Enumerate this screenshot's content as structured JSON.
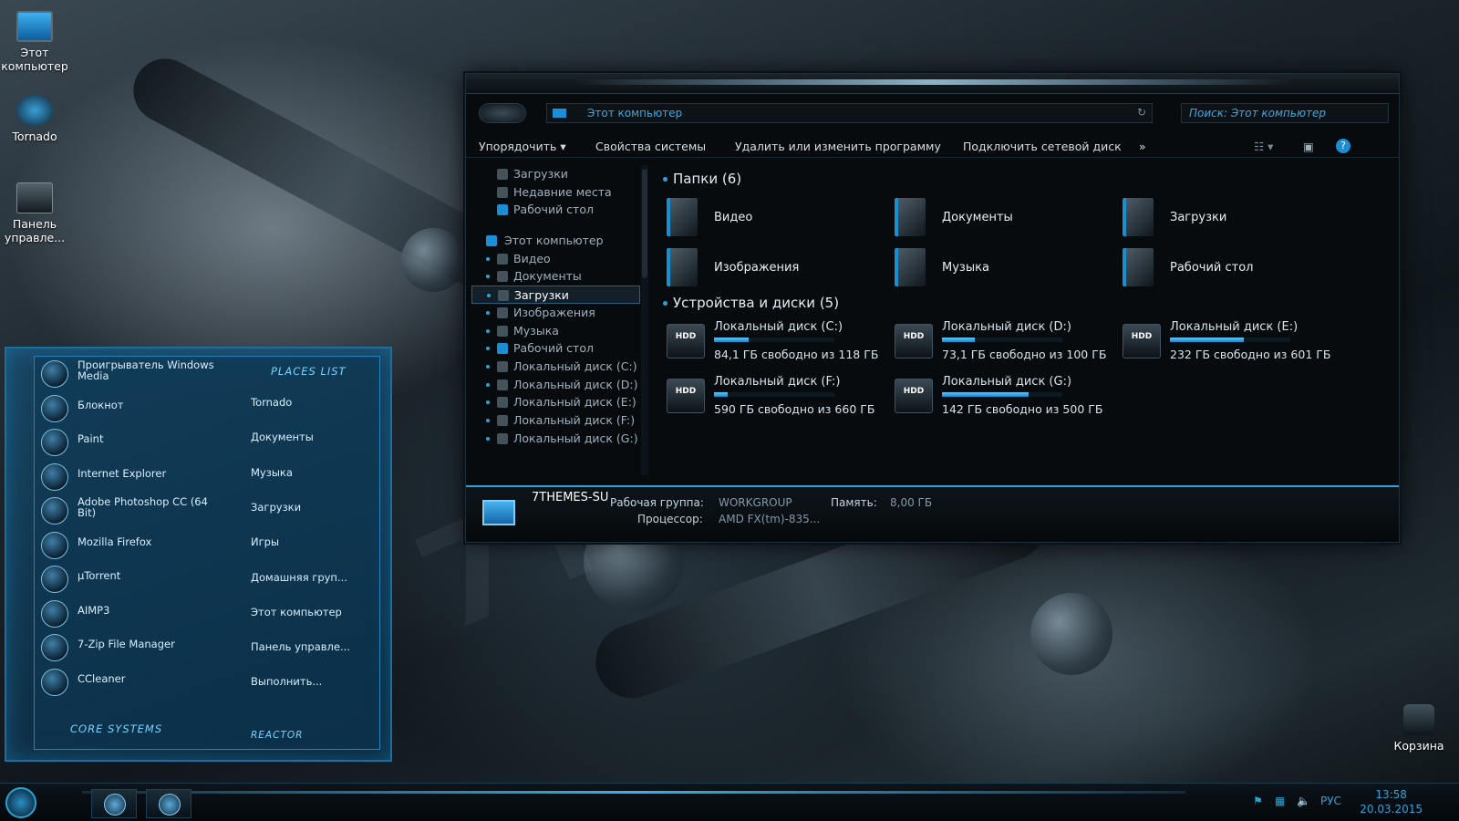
{
  "desktop": {
    "icons": [
      {
        "label": "Этот компьютер",
        "icon": "computer-icon"
      },
      {
        "label": "Tornado",
        "icon": "tornado-icon"
      },
      {
        "label": "Панель управле...",
        "icon": "control-panel-icon"
      },
      {
        "label": "Корзина",
        "icon": "recycle-bin-icon"
      }
    ]
  },
  "explorer": {
    "address": "Этот компьютер",
    "search_placeholder": "Поиск: Этот компьютер",
    "toolbar": {
      "organize": "Упорядочить ▾",
      "system_props": "Свойства системы",
      "uninstall": "Удалить или изменить программу",
      "map_drive": "Подключить сетевой диск",
      "more": "»"
    },
    "nav": [
      {
        "label": "Загрузки"
      },
      {
        "label": "Недавние места"
      },
      {
        "label": "Рабочий стол"
      },
      {
        "label": "Этот компьютер"
      },
      {
        "label": "Видео"
      },
      {
        "label": "Документы"
      },
      {
        "label": "Загрузки"
      },
      {
        "label": "Изображения"
      },
      {
        "label": "Музыка"
      },
      {
        "label": "Рабочий стол"
      },
      {
        "label": "Локальный диск (C:)"
      },
      {
        "label": "Локальный диск (D:)"
      },
      {
        "label": "Локальный диск (E:)"
      },
      {
        "label": "Локальный диск (F:)"
      },
      {
        "label": "Локальный диск (G:)"
      }
    ],
    "folders_header": "Папки (6)",
    "folders": [
      {
        "label": "Видео"
      },
      {
        "label": "Документы"
      },
      {
        "label": "Загрузки"
      },
      {
        "label": "Изображения"
      },
      {
        "label": "Музыка"
      },
      {
        "label": "Рабочий стол"
      }
    ],
    "drives_header": "Устройства и диски (5)",
    "drives": [
      {
        "name": "Локальный диск (C:)",
        "free": "84,1 ГБ свободно из 118 ГБ",
        "used_fraction": 0.29
      },
      {
        "name": "Локальный диск (D:)",
        "free": "73,1 ГБ свободно из 100 ГБ",
        "used_fraction": 0.27
      },
      {
        "name": "Локальный диск (E:)",
        "free": "232 ГБ свободно из 601 ГБ",
        "used_fraction": 0.61
      },
      {
        "name": "Локальный диск (F:)",
        "free": "590 ГБ свободно из 660 ГБ",
        "used_fraction": 0.11
      },
      {
        "name": "Локальный диск (G:)",
        "free": "142 ГБ свободно из 500 ГБ",
        "used_fraction": 0.72
      }
    ],
    "hdd_label": "HDD",
    "details": {
      "name": "7THEMES-SU",
      "workgroup_label": "Рабочая группа:",
      "workgroup": "WORKGROUP",
      "memory_label": "Память:",
      "memory": "8,00 ГБ",
      "cpu_label": "Процессор:",
      "cpu": "AMD FX(tm)-835..."
    }
  },
  "start_menu": {
    "programs": [
      "Проигрыватель Windows Media",
      "Блокнот",
      "Paint",
      "Internet Explorer",
      "Adobe Photoshop CC (64 Bit)",
      "Mozilla Firefox",
      "µTorrent",
      "AIMP3",
      "7-Zip File Manager",
      "CCleaner"
    ],
    "places_header": "PLACES LIST",
    "places": [
      "Tornado",
      "Документы",
      "Музыка",
      "Загрузки",
      "Игры",
      "Домашняя груп...",
      "Этот компьютер",
      "Панель управле...",
      "Выполнить..."
    ],
    "core": "CORE SYSTEMS",
    "reactor": "REACTOR"
  },
  "taskbar": {
    "lang": "РУС",
    "time": "13:58",
    "date": "20.03.2015"
  },
  "watermark": "7THEMES.SU",
  "colors": {
    "accent": "#2aa3d6",
    "panel": "#0c3752",
    "window": "#070b0e"
  }
}
